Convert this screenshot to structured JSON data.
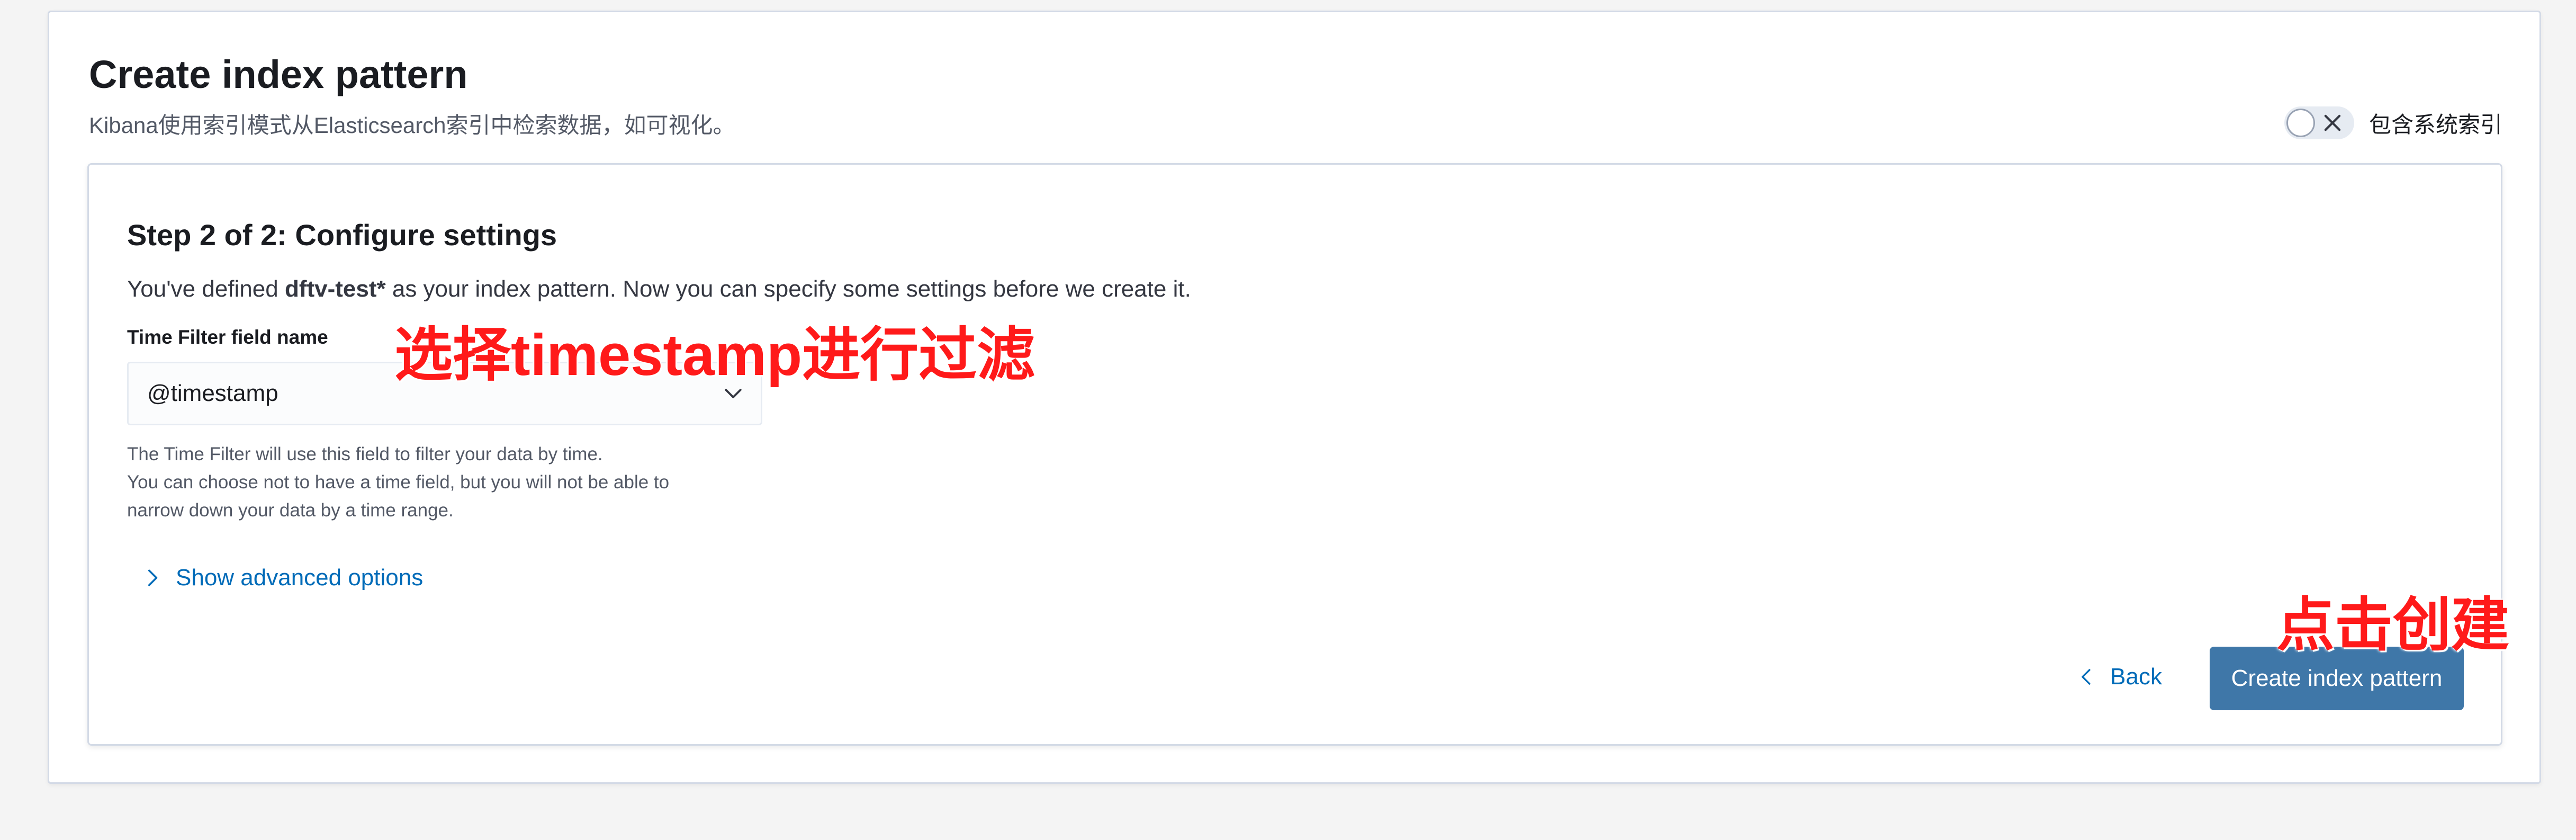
{
  "header": {
    "title": "Create index pattern",
    "subtitle": "Kibana使用索引模式从Elasticsearch索引中检索数据，如可视化。",
    "toggle_label": "包含系统索引",
    "toggle_on": false
  },
  "step": {
    "title": "Step 2 of 2: Configure settings",
    "desc_prefix": "You've defined ",
    "desc_pattern": "dftv-test*",
    "desc_suffix": " as your index pattern. Now you can specify some settings before we create it."
  },
  "time_field": {
    "label": "Time Filter field name",
    "selected": "@timestamp",
    "help_lines": [
      "The Time Filter will use this field to filter your data by time.",
      "You can choose not to have a time field, but you will not be able to",
      "narrow down your data by a time range."
    ]
  },
  "advanced": {
    "label": "Show advanced options"
  },
  "actions": {
    "back_label": "Back",
    "create_label": "Create index pattern"
  },
  "annotations": {
    "select_note": "选择timestamp进行过滤",
    "create_note": "点击创建"
  },
  "icons": {
    "toggle": "close-icon",
    "select": "chevron-down-icon",
    "advanced": "chevron-right-icon",
    "back": "chevron-left-icon"
  },
  "colors": {
    "primary_button": "#3f77a8",
    "link": "#006bb8",
    "annotation": "#ff1a1a"
  }
}
